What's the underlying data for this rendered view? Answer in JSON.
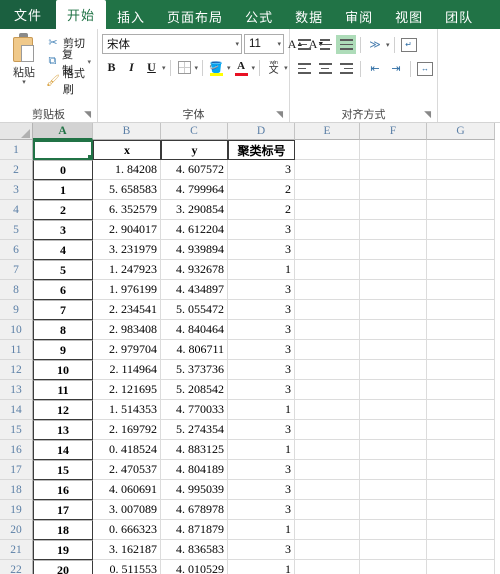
{
  "ribbon": {
    "tabs": [
      {
        "label": "文件",
        "name": "tab-file",
        "active": false,
        "file": true
      },
      {
        "label": "开始",
        "name": "tab-home",
        "active": true
      },
      {
        "label": "插入",
        "name": "tab-insert",
        "active": false
      },
      {
        "label": "页面布局",
        "name": "tab-page-layout",
        "active": false
      },
      {
        "label": "公式",
        "name": "tab-formulas",
        "active": false
      },
      {
        "label": "数据",
        "name": "tab-data",
        "active": false
      },
      {
        "label": "审阅",
        "name": "tab-review",
        "active": false
      },
      {
        "label": "视图",
        "name": "tab-view",
        "active": false
      },
      {
        "label": "团队",
        "name": "tab-team",
        "active": false
      }
    ],
    "clipboard": {
      "group_label": "剪贴板",
      "paste_label": "粘贴",
      "cut_label": "剪切",
      "copy_label": "复制",
      "format_painter_label": "格式刷"
    },
    "font": {
      "group_label": "字体",
      "font_name": "宋体",
      "font_size": "11",
      "bold_label": "B",
      "italic_label": "I",
      "underline_label": "U",
      "grow_font_label": "A",
      "shrink_font_label": "A",
      "font_color_label": "A",
      "phonetic_top": "wén",
      "phonetic_bottom": "文"
    },
    "alignment": {
      "group_label": "对齐方式"
    }
  },
  "sheet": {
    "columns": [
      "A",
      "B",
      "C",
      "D",
      "E",
      "F",
      "G"
    ],
    "selected_column": "A",
    "active_cell": "A1",
    "row_numbers": [
      1,
      2,
      3,
      4,
      5,
      6,
      7,
      8,
      9,
      10,
      11,
      12,
      13,
      14,
      15,
      16,
      17,
      18,
      19,
      20,
      21,
      22
    ],
    "headers": {
      "a": "",
      "b": "x",
      "c": "y",
      "d": "聚类标号"
    },
    "rows": [
      {
        "a": "0",
        "b": "1. 84208",
        "c": "4. 607572",
        "d": "3"
      },
      {
        "a": "1",
        "b": "5. 658583",
        "c": "4. 799964",
        "d": "2"
      },
      {
        "a": "2",
        "b": "6. 352579",
        "c": "3. 290854",
        "d": "2"
      },
      {
        "a": "3",
        "b": "2. 904017",
        "c": "4. 612204",
        "d": "3"
      },
      {
        "a": "4",
        "b": "3. 231979",
        "c": "4. 939894",
        "d": "3"
      },
      {
        "a": "5",
        "b": "1. 247923",
        "c": "4. 932678",
        "d": "1"
      },
      {
        "a": "6",
        "b": "1. 976199",
        "c": "4. 434897",
        "d": "3"
      },
      {
        "a": "7",
        "b": "2. 234541",
        "c": "5. 055472",
        "d": "3"
      },
      {
        "a": "8",
        "b": "2. 983408",
        "c": "4. 840464",
        "d": "3"
      },
      {
        "a": "9",
        "b": "2. 979704",
        "c": "4. 806711",
        "d": "3"
      },
      {
        "a": "10",
        "b": "2. 114964",
        "c": "5. 373736",
        "d": "3"
      },
      {
        "a": "11",
        "b": "2. 121695",
        "c": "5. 208542",
        "d": "3"
      },
      {
        "a": "12",
        "b": "1. 514353",
        "c": "4. 770033",
        "d": "1"
      },
      {
        "a": "13",
        "b": "2. 169792",
        "c": "5. 274354",
        "d": "3"
      },
      {
        "a": "14",
        "b": "0. 418524",
        "c": "4. 883125",
        "d": "1"
      },
      {
        "a": "15",
        "b": "2. 470537",
        "c": "4. 804189",
        "d": "3"
      },
      {
        "a": "16",
        "b": "4. 060691",
        "c": "4. 995039",
        "d": "3"
      },
      {
        "a": "17",
        "b": "3. 007089",
        "c": "4. 678978",
        "d": "3"
      },
      {
        "a": "18",
        "b": "0. 666323",
        "c": "4. 871879",
        "d": "1"
      },
      {
        "a": "19",
        "b": "3. 162187",
        "c": "4. 836583",
        "d": "3"
      },
      {
        "a": "20",
        "b": "0. 511553",
        "c": "4. 010529",
        "d": "1"
      }
    ]
  },
  "colors": {
    "brand_green": "#217346",
    "selection_green": "#aedcb9",
    "highlight_yellow": "#ffff00",
    "font_color_red": "#e81123"
  }
}
